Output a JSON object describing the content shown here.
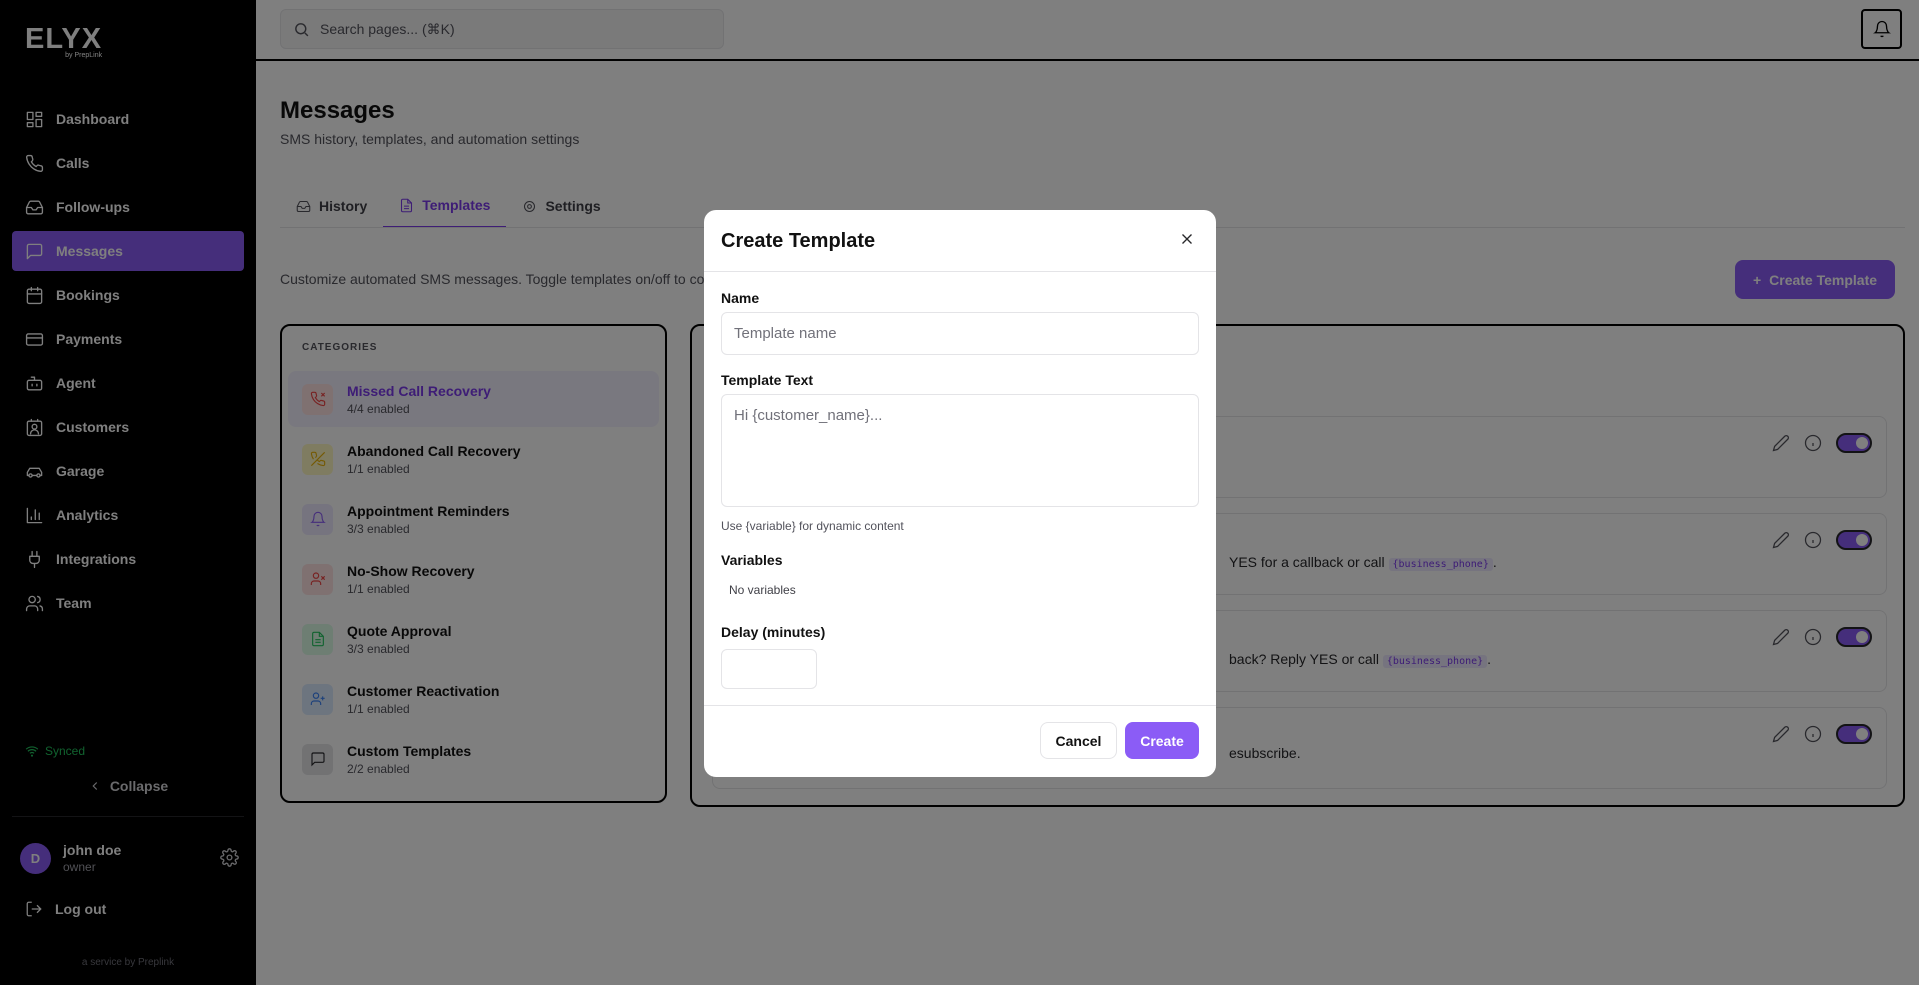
{
  "sidebar": {
    "logo": "ELYX",
    "logo_sub": "by PrepLink",
    "items": [
      {
        "label": "Dashboard",
        "icon": "dashboard-icon"
      },
      {
        "label": "Calls",
        "icon": "phone-icon"
      },
      {
        "label": "Follow-ups",
        "icon": "inbox-icon"
      },
      {
        "label": "Messages",
        "icon": "message-icon",
        "active": true
      },
      {
        "label": "Bookings",
        "icon": "calendar-icon"
      },
      {
        "label": "Payments",
        "icon": "credit-card-icon"
      },
      {
        "label": "Agent",
        "icon": "bot-icon"
      },
      {
        "label": "Customers",
        "icon": "contact-icon"
      },
      {
        "label": "Garage",
        "icon": "car-icon"
      },
      {
        "label": "Analytics",
        "icon": "chart-icon"
      },
      {
        "label": "Integrations",
        "icon": "plug-icon"
      },
      {
        "label": "Team",
        "icon": "users-icon"
      }
    ],
    "synced": "Synced",
    "collapse": "Collapse",
    "user": {
      "initial": "D",
      "name": "john doe",
      "role": "owner"
    },
    "logout": "Log out",
    "service": "a service by Preplink"
  },
  "topbar": {
    "search_placeholder": "Search pages... (⌘K)"
  },
  "page": {
    "title": "Messages",
    "subtitle": "SMS history, templates, and automation settings",
    "tabs": [
      {
        "label": "History",
        "icon": "inbox-icon"
      },
      {
        "label": "Templates",
        "icon": "file-text-icon",
        "active": true
      },
      {
        "label": "Settings",
        "icon": "gear-icon"
      }
    ],
    "description": "Customize automated SMS messages. Toggle templates on/off to co",
    "create_button": "Create Template"
  },
  "categories": {
    "heading": "CATEGORIES",
    "items": [
      {
        "name": "Missed Call Recovery",
        "count": "4/4 enabled",
        "icon": "phone-missed-icon",
        "color": "#ef4444",
        "bg": "#fee2e2",
        "active": true
      },
      {
        "name": "Abandoned Call Recovery",
        "count": "1/1 enabled",
        "icon": "phone-off-icon",
        "color": "#eab308",
        "bg": "#fef9c3"
      },
      {
        "name": "Appointment Reminders",
        "count": "3/3 enabled",
        "icon": "bell-icon",
        "color": "#8b5cf6",
        "bg": "#ede9fe"
      },
      {
        "name": "No-Show Recovery",
        "count": "1/1 enabled",
        "icon": "user-x-icon",
        "color": "#ef4444",
        "bg": "#fee2e2"
      },
      {
        "name": "Quote Approval",
        "count": "3/3 enabled",
        "icon": "file-icon",
        "color": "#22c55e",
        "bg": "#dcfce7"
      },
      {
        "name": "Customer Reactivation",
        "count": "1/1 enabled",
        "icon": "user-plus-icon",
        "color": "#3b82f6",
        "bg": "#dbeafe"
      },
      {
        "name": "Custom Templates",
        "count": "2/2 enabled",
        "icon": "message-square-icon",
        "color": "#27272a",
        "bg": "#e4e4e7"
      }
    ]
  },
  "templates": [
    {
      "text": "",
      "chip": ""
    },
    {
      "text": "YES for a callback or call ",
      "chip": "{business_phone}",
      "end": "."
    },
    {
      "text": "back? Reply YES or call ",
      "chip": "{business_phone}",
      "end": "."
    },
    {
      "text": "esubscribe.",
      "chip": "",
      "end": ""
    }
  ],
  "modal": {
    "title": "Create Template",
    "name_label": "Name",
    "name_placeholder": "Template name",
    "text_label": "Template Text",
    "text_placeholder": "Hi {customer_name}...",
    "hint": "Use {variable} for dynamic content",
    "variables_label": "Variables",
    "no_variables": "No variables",
    "delay_label": "Delay (minutes)",
    "cancel": "Cancel",
    "create": "Create"
  }
}
